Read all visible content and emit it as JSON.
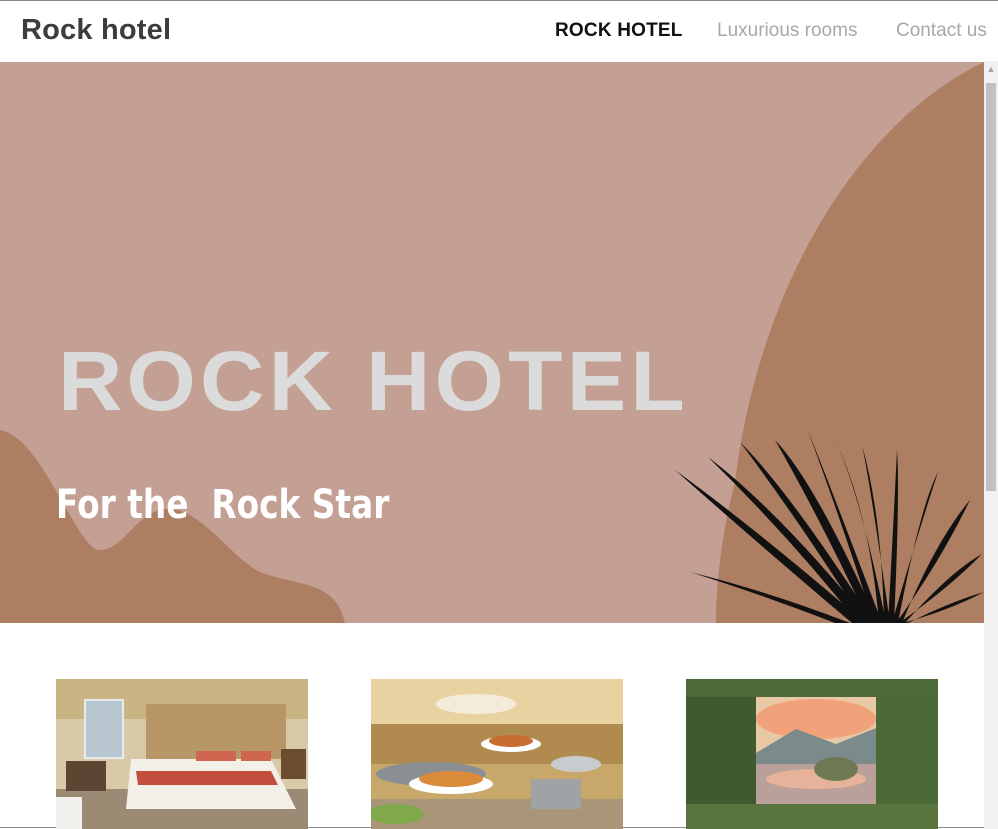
{
  "navbar": {
    "brand": "Rock hotel",
    "links": [
      {
        "label": "ROCK HOTEL",
        "active": true
      },
      {
        "label": "Luxurious rooms",
        "active": false
      },
      {
        "label": "Contact us",
        "active": false
      }
    ]
  },
  "hero": {
    "title": "ROCK HOTEL",
    "subtitle": "For the  Rock Star"
  },
  "cards": [
    {
      "image": "hotel-bedroom-photo"
    },
    {
      "image": "buffet-food-photo"
    },
    {
      "image": "lake-landscape-photo"
    }
  ],
  "colors": {
    "hero_background": "#c3a093",
    "hero_shape": "#ad7e62",
    "brand_text": "#3c3d41"
  }
}
